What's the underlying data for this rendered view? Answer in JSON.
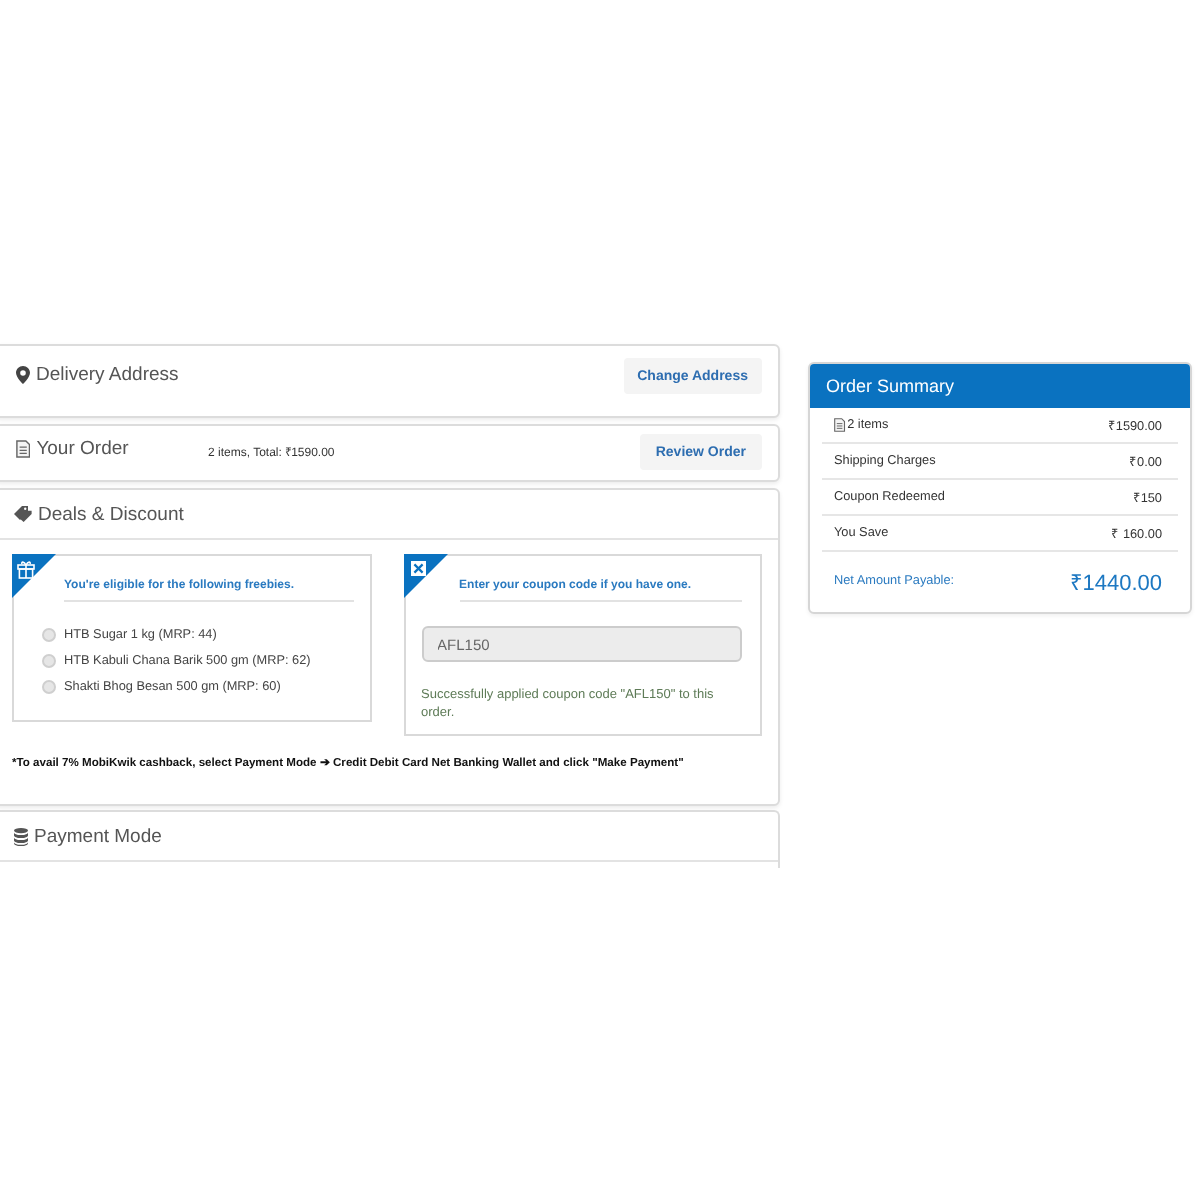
{
  "delivery_address": {
    "title": "Delivery Address",
    "button": "Change Address"
  },
  "your_order": {
    "title": "Your Order",
    "summary": "2 items, Total: ₹1590.00",
    "button": "Review Order"
  },
  "deals": {
    "title": "Deals & Discount",
    "freebies": {
      "heading": "You're eligible for the following freebies.",
      "items": [
        {
          "label": "HTB Sugar 1 kg (MRP: 44)",
          "selected": false
        },
        {
          "label": "HTB Kabuli Chana Barik 500 gm (MRP: 62)",
          "selected": false
        },
        {
          "label": "Shakti Bhog Besan 500 gm (MRP: 60)",
          "selected": false
        }
      ]
    },
    "coupon": {
      "heading": "Enter your coupon code if you have one.",
      "value": "AFL150",
      "disabled": true,
      "message": "Successfully applied coupon code \"AFL150\" to this order."
    },
    "note": "*To avail 7% MobiKwik cashback, select Payment Mode ➔ Credit Debit Card Net Banking Wallet and click \"Make Payment\""
  },
  "payment_mode": {
    "title": "Payment Mode"
  },
  "order_summary": {
    "title": "Order Summary",
    "rows": [
      {
        "kind": "items",
        "label": "2 items",
        "value": "₹1590.00"
      },
      {
        "kind": "charge",
        "label": "Shipping Charges",
        "value": "₹0.00"
      },
      {
        "kind": "charge",
        "label": "Coupon Redeemed",
        "value": "₹150"
      },
      {
        "kind": "charge",
        "label": "You Save",
        "value": "₹ 160.00"
      }
    ],
    "total": {
      "label": "Net Amount Payable:",
      "value": "₹1440.00"
    }
  }
}
